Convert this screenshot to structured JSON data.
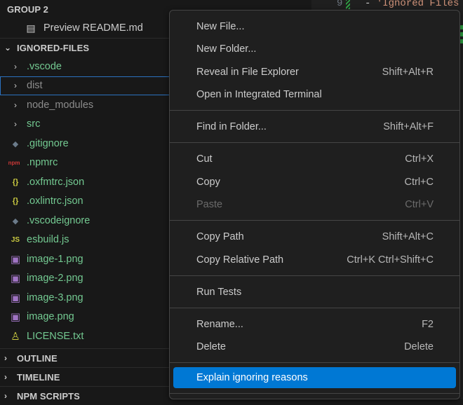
{
  "editor": {
    "line_number": "9",
    "code_dash": "- ",
    "code_text": "'Ignored Files"
  },
  "explorer": {
    "group_header": "GROUP 2",
    "group_item": {
      "label": "Preview README.md",
      "icon": "preview-icon"
    },
    "folder_header": "IGNORED-FILES",
    "items": [
      {
        "label": ".vscode",
        "kind": "folder",
        "icon": "chevron-right-icon"
      },
      {
        "label": "dist",
        "kind": "folder",
        "icon": "chevron-right-icon"
      },
      {
        "label": "node_modules",
        "kind": "folder",
        "icon": "chevron-right-icon"
      },
      {
        "label": "src",
        "kind": "folder",
        "icon": "chevron-right-icon"
      },
      {
        "label": ".gitignore",
        "kind": "file",
        "icon": "git-icon",
        "glyph": "◆"
      },
      {
        "label": ".npmrc",
        "kind": "file",
        "icon": "npm-icon",
        "glyph": "npm"
      },
      {
        "label": ".oxfmtrc.json",
        "kind": "file",
        "icon": "json-icon",
        "glyph": "{}"
      },
      {
        "label": ".oxlintrc.json",
        "kind": "file",
        "icon": "json-icon",
        "glyph": "{}"
      },
      {
        "label": ".vscodeignore",
        "kind": "file",
        "icon": "vscode-ignore-icon",
        "glyph": "◆"
      },
      {
        "label": "esbuild.js",
        "kind": "file",
        "icon": "js-icon",
        "glyph": "JS"
      },
      {
        "label": "image-1.png",
        "kind": "file",
        "icon": "image-icon",
        "glyph": "▣"
      },
      {
        "label": "image-2.png",
        "kind": "file",
        "icon": "image-icon",
        "glyph": "▣"
      },
      {
        "label": "image-3.png",
        "kind": "file",
        "icon": "image-icon",
        "glyph": "▣"
      },
      {
        "label": "image.png",
        "kind": "file",
        "icon": "image-icon",
        "glyph": "▣"
      },
      {
        "label": "LICENSE.txt",
        "kind": "file",
        "icon": "license-icon",
        "glyph": "♙"
      }
    ],
    "sections": [
      "OUTLINE",
      "TIMELINE",
      "NPM SCRIPTS"
    ]
  },
  "context_menu": {
    "items": [
      {
        "label": "New File...",
        "shortcut": ""
      },
      {
        "label": "New Folder...",
        "shortcut": ""
      },
      {
        "label": "Reveal in File Explorer",
        "shortcut": "Shift+Alt+R"
      },
      {
        "label": "Open in Integrated Terminal",
        "shortcut": ""
      },
      {
        "label": "Find in Folder...",
        "shortcut": "Shift+Alt+F"
      },
      {
        "label": "Cut",
        "shortcut": "Ctrl+X"
      },
      {
        "label": "Copy",
        "shortcut": "Ctrl+C"
      },
      {
        "label": "Paste",
        "shortcut": "Ctrl+V",
        "disabled": true
      },
      {
        "label": "Copy Path",
        "shortcut": "Shift+Alt+C"
      },
      {
        "label": "Copy Relative Path",
        "shortcut": "Ctrl+K Ctrl+Shift+C"
      },
      {
        "label": "Run Tests",
        "shortcut": ""
      },
      {
        "label": "Rename...",
        "shortcut": "F2"
      },
      {
        "label": "Delete",
        "shortcut": "Delete"
      },
      {
        "label": "Explain ignoring reasons",
        "shortcut": "",
        "active": true
      }
    ]
  },
  "colors": {
    "accent": "#0078d4",
    "ignored_text": "#8c8c8c",
    "untracked_green": "#73c991",
    "selection_border": "#2b72c0"
  }
}
